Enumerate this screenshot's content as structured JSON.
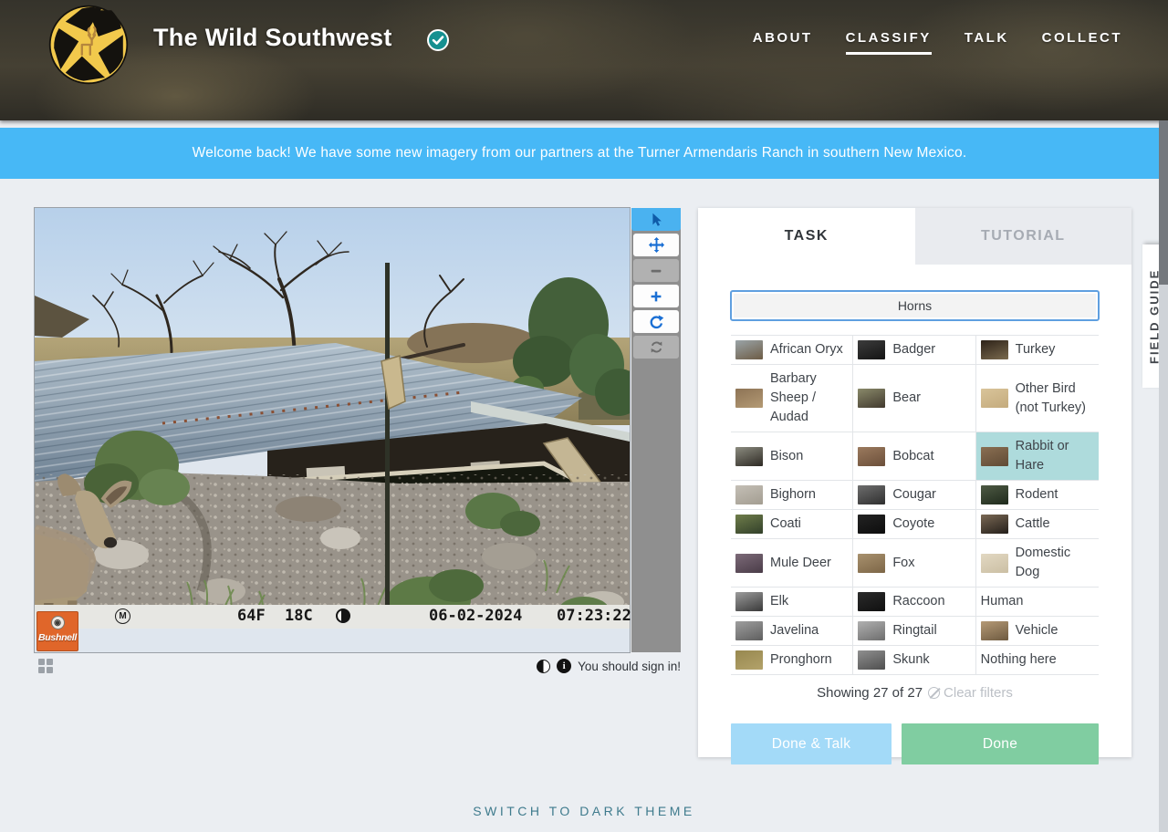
{
  "colors": {
    "banner": "#47b8f6",
    "chipBorder": "#5f9fe0",
    "selected": "#aedbdc",
    "doneTalk": "#a3daf8",
    "done": "#80cda1",
    "link": "#3f7b8d",
    "logoYellow": "#f2c94c",
    "badgeTeal": "#159090",
    "bushnellOrange": "#e0662a"
  },
  "header": {
    "title": "The Wild Southwest",
    "badge": "approved-check",
    "nav": [
      {
        "label": "ABOUT",
        "active": false
      },
      {
        "label": "CLASSIFY",
        "active": true
      },
      {
        "label": "TALK",
        "active": false
      },
      {
        "label": "COLLECT",
        "active": false
      }
    ]
  },
  "banner": {
    "message": "Welcome back! We have some new imagery from our partners at the Turner Armendaris Ranch in southern New Mexico."
  },
  "viewer": {
    "toolbar": [
      {
        "name": "annotate-tool",
        "icon": "pointer",
        "state": "active"
      },
      {
        "name": "move-tool",
        "icon": "move",
        "state": "normal"
      },
      {
        "name": "zoom-out-tool",
        "icon": "zoom-out",
        "state": "disabled"
      },
      {
        "name": "zoom-in-tool",
        "icon": "zoom-in",
        "state": "normal"
      },
      {
        "name": "rotate-tool",
        "icon": "rotate",
        "state": "normal"
      },
      {
        "name": "reset-tool",
        "icon": "reset",
        "state": "disabled"
      }
    ],
    "camera_bar": {
      "brand": "Bushnell",
      "mode": "M",
      "temp_f": "64F",
      "temp_c": "18C",
      "moon_icon": "moon-phase-icon",
      "date": "06-02-2024",
      "time": "07:23:22"
    },
    "below": {
      "grid_icon": "subject-grid-icon",
      "invert_icon": "invert-colors-icon",
      "metadata_icon": "metadata-info-icon",
      "signin_hint": "You should sign in!"
    }
  },
  "task_panel": {
    "tabs": [
      {
        "label": "TASK",
        "active": true
      },
      {
        "label": "TUTORIAL",
        "active": false
      }
    ],
    "filter_chip": "Horns",
    "species": [
      {
        "label": "African Oryx",
        "thumb": [
          "#9aa4a8",
          "#6d5c45"
        ],
        "selected": false
      },
      {
        "label": "Badger",
        "thumb": [
          "#3c3c3c",
          "#141414"
        ],
        "selected": false
      },
      {
        "label": "Turkey",
        "thumb": [
          "#2d2218",
          "#7a6a4e"
        ],
        "selected": false
      },
      {
        "label": "Barbary Sheep / Audad",
        "thumb": [
          "#8d7355",
          "#b49a74"
        ],
        "selected": false
      },
      {
        "label": "Bear",
        "thumb": [
          "#8a8a6a",
          "#41392e"
        ],
        "selected": false
      },
      {
        "label": "Other Bird (not Turkey)",
        "thumb": [
          "#d9c49a",
          "#c4ab7d"
        ],
        "selected": false
      },
      {
        "label": "Bison",
        "thumb": [
          "#8c8c80",
          "#2e2a24"
        ],
        "selected": false
      },
      {
        "label": "Bobcat",
        "thumb": [
          "#9b7a5e",
          "#6b4f3a"
        ],
        "selected": false
      },
      {
        "label": "Rabbit or Hare",
        "thumb": [
          "#8a6f52",
          "#5f4a35"
        ],
        "selected": true
      },
      {
        "label": "Bighorn",
        "thumb": [
          "#c4bfb6",
          "#a39d91"
        ],
        "selected": false
      },
      {
        "label": "Cougar",
        "thumb": [
          "#6e6e6e",
          "#2f2f2f"
        ],
        "selected": false
      },
      {
        "label": "Rodent",
        "thumb": [
          "#4e5a44",
          "#1f2a1c"
        ],
        "selected": false
      },
      {
        "label": "Coati",
        "thumb": [
          "#6f7d4a",
          "#32402a"
        ],
        "selected": false
      },
      {
        "label": "Coyote",
        "thumb": [
          "#232323",
          "#0d0d0d"
        ],
        "selected": false
      },
      {
        "label": "Cattle",
        "thumb": [
          "#7a6854",
          "#241f1a"
        ],
        "selected": false
      },
      {
        "label": "Mule Deer",
        "thumb": [
          "#7c6a78",
          "#4a3c48"
        ],
        "selected": false
      },
      {
        "label": "Fox",
        "thumb": [
          "#a8916e",
          "#7d6647"
        ],
        "selected": false
      },
      {
        "label": "Domestic Dog",
        "thumb": [
          "#e2d8c2",
          "#cbbfa4"
        ],
        "selected": false
      },
      {
        "label": "Elk",
        "thumb": [
          "#9c9c9c",
          "#3a3a3a"
        ],
        "selected": false
      },
      {
        "label": "Raccoon",
        "thumb": [
          "#2b2b2b",
          "#101010"
        ],
        "selected": false
      },
      {
        "label": "Human",
        "thumb": null,
        "selected": false
      },
      {
        "label": "Javelina",
        "thumb": [
          "#9e9e9e",
          "#5f5f5f"
        ],
        "selected": false
      },
      {
        "label": "Ringtail",
        "thumb": [
          "#b0b0b0",
          "#6e6e6e"
        ],
        "selected": false
      },
      {
        "label": "Vehicle",
        "thumb": [
          "#b59a76",
          "#6e5a40"
        ],
        "selected": false
      },
      {
        "label": "Pronghorn",
        "thumb": [
          "#97884f",
          "#b3a26a"
        ],
        "selected": false
      },
      {
        "label": "Skunk",
        "thumb": [
          "#8f8f8f",
          "#4f4f4f"
        ],
        "selected": false
      },
      {
        "label": "Nothing here",
        "thumb": null,
        "selected": false
      }
    ],
    "showing": "Showing 27 of 27",
    "clear_filters": "Clear filters",
    "done_talk_label": "Done & Talk",
    "done_label": "Done"
  },
  "field_guide": {
    "label": "FIELD GUIDE"
  },
  "footer": {
    "theme_toggle": "SWITCH TO DARK THEME"
  }
}
